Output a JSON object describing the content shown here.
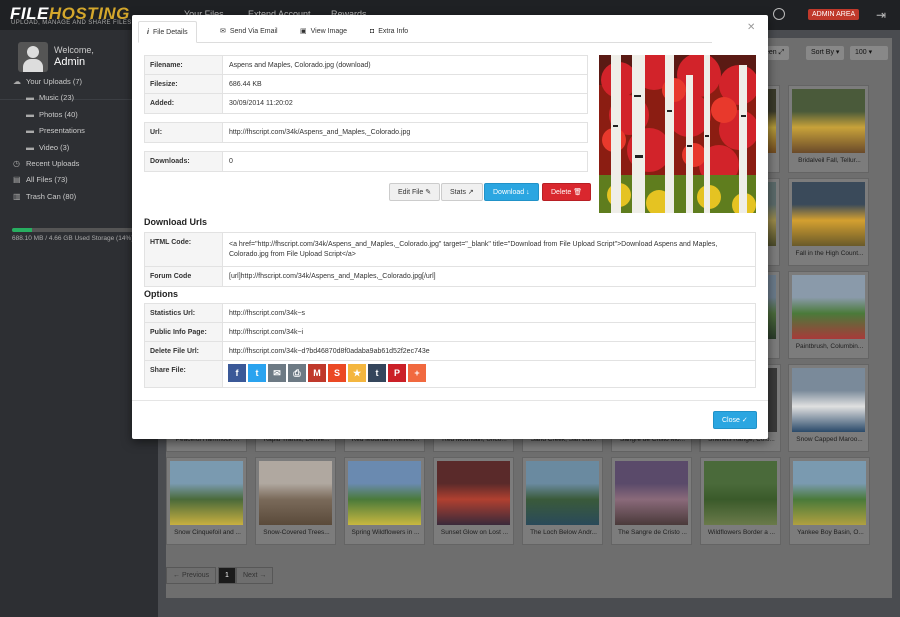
{
  "app": {
    "logo_part1": "FILE",
    "logo_part2": "HOSTING",
    "tagline": "UPLOAD, MANAGE AND SHARE FILES",
    "nav": [
      "Your Files",
      "Extend Account",
      "Rewards"
    ],
    "admin_label": "ADMIN AREA"
  },
  "user": {
    "welcome": "Welcome,",
    "name": "Admin"
  },
  "sidebar": {
    "items": [
      {
        "label": "Your Uploads (7)",
        "icon": "cloud-upload-icon",
        "sub": false
      },
      {
        "label": "Music (23)",
        "icon": "folder-icon",
        "sub": true
      },
      {
        "label": "Photos (40)",
        "icon": "folder-icon",
        "sub": true
      },
      {
        "label": "Presentations",
        "icon": "folder-icon",
        "sub": true
      },
      {
        "label": "Video (3)",
        "icon": "folder-icon",
        "sub": true
      },
      {
        "label": "Recent Uploads",
        "icon": "clock-icon",
        "sub": false
      },
      {
        "label": "All Files (73)",
        "icon": "files-icon",
        "sub": false
      },
      {
        "label": "Trash Can (80)",
        "icon": "trash-icon",
        "sub": false
      }
    ],
    "storage_text": "688.10 MB / 4.66 GB Used Storage (14%)",
    "storage_percent": 14
  },
  "toolbar": {
    "view_label": "een",
    "sort_label": "Sort By",
    "per_page": "100"
  },
  "thumbnails": [
    {
      "caption": "",
      "colors": [
        "#3a3a2a",
        "#b49a3a",
        "#704a20"
      ]
    },
    {
      "caption": "Bridalveil Fall, Tellur...",
      "colors": [
        "#4a5a3a",
        "#c8a23a",
        "#6a4a2a"
      ]
    },
    {
      "caption": "",
      "colors": [
        "#5a6a6a",
        "#9a8a4a",
        "#4a4a2a"
      ]
    },
    {
      "caption": "Fall in the High Count...",
      "colors": [
        "#3a4a5a",
        "#d4a030",
        "#6a5a2a"
      ]
    },
    {
      "caption": "",
      "colors": [
        "#6a7a8a",
        "#4a6a3a",
        "#2a3a2a"
      ]
    },
    {
      "caption": "Paintbrush, Columbin...",
      "colors": [
        "#8a9aaa",
        "#4a7a3a",
        "#a83a3a"
      ]
    },
    {
      "caption": "",
      "colors": [
        "#6a7a8a",
        "#3a4a3a",
        "#2a2a2a"
      ]
    },
    {
      "caption": "Snow Capped Maroo...",
      "colors": [
        "#7a8a9a",
        "#e0e0e0",
        "#2a4a6a"
      ]
    },
    {
      "caption": "Peaceful Hammock ...",
      "colors": [
        "#3a3a3a",
        "#3a3a3a",
        "#3a3a3a"
      ]
    },
    {
      "caption": "Rapid Transit, Denve...",
      "colors": [
        "#3a3a3a",
        "#3a3a3a",
        "#3a3a3a"
      ]
    },
    {
      "caption": "Red Mountain Reflect...",
      "colors": [
        "#3a3a3a",
        "#3a3a3a",
        "#3a3a3a"
      ]
    },
    {
      "caption": "Red Mountain, Unco...",
      "colors": [
        "#3a3a3a",
        "#3a3a3a",
        "#3a3a3a"
      ]
    },
    {
      "caption": "Sand Creek, San Lui...",
      "colors": [
        "#3a3a3a",
        "#3a3a3a",
        "#3a3a3a"
      ]
    },
    {
      "caption": "Sangre de Cristo Mo...",
      "colors": [
        "#3a3a3a",
        "#3a3a3a",
        "#3a3a3a"
      ]
    },
    {
      "caption": "Sheffels Range, Colo...",
      "colors": [
        "#3a3a3a",
        "#3a3a3a",
        "#3a3a3a"
      ]
    },
    {
      "caption": "Snow Cinquefoil and ...",
      "colors": [
        "#7a9ab0",
        "#4a6a3a",
        "#c8b040"
      ]
    },
    {
      "caption": "Snow-Covered Trees...",
      "colors": [
        "#b0a8a0",
        "#7a6a5a",
        "#5a4a3a"
      ]
    },
    {
      "caption": "Spring Wildflowers in ...",
      "colors": [
        "#6a8ab0",
        "#4a7a3a",
        "#c8b840"
      ]
    },
    {
      "caption": "Sunset Glow on Lost ...",
      "colors": [
        "#5a2a2a",
        "#b04030",
        "#3a2a3a"
      ]
    },
    {
      "caption": "The Loch Below Andr...",
      "colors": [
        "#6a8aa0",
        "#3a5a3a",
        "#2a4a5a"
      ]
    },
    {
      "caption": "The Sangre de Cristo ...",
      "colors": [
        "#5a4a6a",
        "#8a6a7a",
        "#4a3a3a"
      ]
    },
    {
      "caption": "Wildflowers Border a ...",
      "colors": [
        "#4a6a3a",
        "#3a5a2a",
        "#6a7a4a"
      ]
    },
    {
      "caption": "Yankee Boy Basin, O...",
      "colors": [
        "#7a9ab0",
        "#4a7a3a",
        "#b0a040"
      ]
    }
  ],
  "pagination": {
    "previous": "← Previous",
    "current": "1",
    "next": "Next →"
  },
  "modal": {
    "tabs": [
      {
        "label": "File Details",
        "icon": "info-icon",
        "glyph": "i"
      },
      {
        "label": "Send Via Email",
        "icon": "envelope-icon",
        "glyph": "✉"
      },
      {
        "label": "View Image",
        "icon": "image-icon",
        "glyph": "▣"
      },
      {
        "label": "Extra Info",
        "icon": "camera-icon",
        "glyph": "◘"
      }
    ],
    "details": {
      "filename_label": "Filename:",
      "filename": "Aspens and Maples, Colorado.jpg  (download)",
      "filesize_label": "Filesize:",
      "filesize": "686.44 KB",
      "added_label": "Added:",
      "added": "30/09/2014 11:20:02",
      "url_label": "Url:",
      "url": "http://fhscript.com/34k/Aspens_and_Maples,_Colorado.jpg",
      "downloads_label": "Downloads:",
      "downloads": "0"
    },
    "buttons": {
      "edit": "Edit File",
      "stats": "Stats",
      "download": "Download",
      "delete": "Delete"
    },
    "download_urls_title": "Download Urls",
    "html_code_label": "HTML Code:",
    "html_code": "<a href=\"http://fhscript.com/34k/Aspens_and_Maples,_Colorado.jpg\" target=\"_blank\" title=\"Download from File Upload Script\">Download Aspens and Maples, Colorado.jpg from File Upload Script</a>",
    "forum_code_label": "Forum Code",
    "forum_code": "[url]http://fhscript.com/34k/Aspens_and_Maples,_Colorado.jpg[/url]",
    "options_title": "Options",
    "stats_url_label": "Statistics Url:",
    "stats_url": "http://fhscript.com/34k~s",
    "public_info_label": "Public Info Page:",
    "public_info": "http://fhscript.com/34k~i",
    "delete_url_label": "Delete File Url:",
    "delete_url": "http://fhscript.com/34k~d?bd46870d8f0adaba9ab61d52f2ec743e",
    "share_label": "Share File:",
    "share": [
      {
        "name": "facebook-icon",
        "glyph": "f",
        "color": "#3b5998"
      },
      {
        "name": "twitter-icon",
        "glyph": "t",
        "color": "#2aa3ef"
      },
      {
        "name": "email-icon",
        "glyph": "✉",
        "color": "#6d7a84"
      },
      {
        "name": "print-icon",
        "glyph": "⎙",
        "color": "#6d7a84"
      },
      {
        "name": "gmail-icon",
        "glyph": "M",
        "color": "#c0392b"
      },
      {
        "name": "stumbleupon-icon",
        "glyph": "S",
        "color": "#eb4924"
      },
      {
        "name": "favorites-icon",
        "glyph": "★",
        "color": "#f4b63f"
      },
      {
        "name": "tumblr-icon",
        "glyph": "t",
        "color": "#35465c"
      },
      {
        "name": "pinterest-icon",
        "glyph": "P",
        "color": "#cb2027"
      },
      {
        "name": "more-icon",
        "glyph": "+",
        "color": "#f1693f"
      }
    ],
    "close_label": "Close ✓"
  }
}
